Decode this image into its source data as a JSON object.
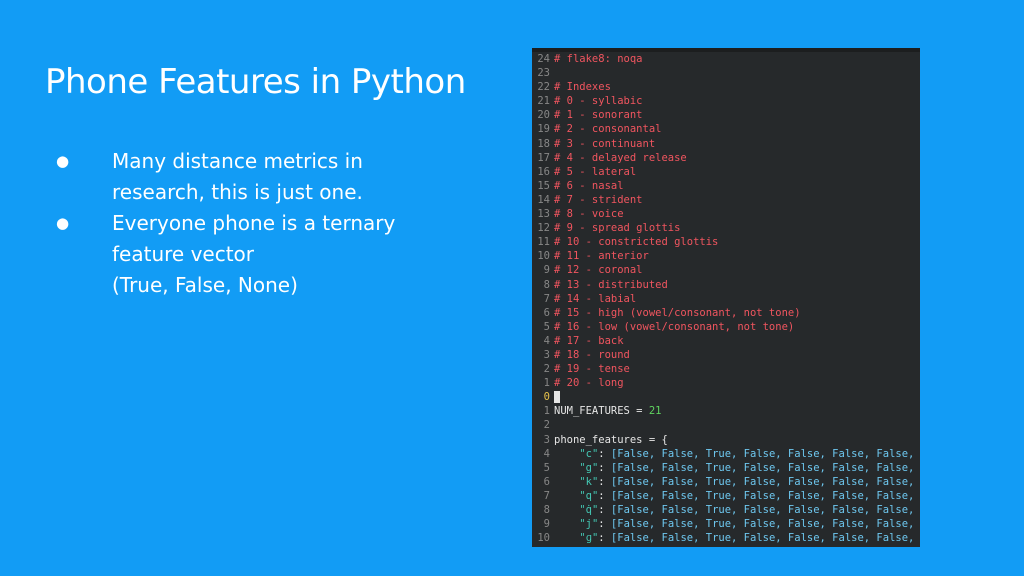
{
  "slide": {
    "title": "Phone Features in Python",
    "bullets": [
      {
        "lines": [
          "Many distance metrics in",
          "research, this is just one."
        ]
      },
      {
        "lines": [
          "Everyone phone is a ternary",
          "feature vector",
          "(True, False, None)"
        ]
      }
    ],
    "bullet_symbol": "●"
  },
  "editor": {
    "colors": {
      "background": "#26292b",
      "comment": "#f0555f",
      "string": "#44c8b4",
      "number": "#5fd35f",
      "line_number": "#878787",
      "current_line_number": "#e6c14c"
    },
    "comment_lines": [
      {
        "ln": "24",
        "text": "# flake8: noqa"
      },
      {
        "ln": "23",
        "text": ""
      },
      {
        "ln": "22",
        "text": "# Indexes"
      },
      {
        "ln": "21",
        "text": "# 0 - syllabic"
      },
      {
        "ln": "20",
        "text": "# 1 - sonorant"
      },
      {
        "ln": "19",
        "text": "# 2 - consonantal"
      },
      {
        "ln": "18",
        "text": "# 3 - continuant"
      },
      {
        "ln": "17",
        "text": "# 4 - delayed release"
      },
      {
        "ln": "16",
        "text": "# 5 - lateral"
      },
      {
        "ln": "15",
        "text": "# 6 - nasal"
      },
      {
        "ln": "14",
        "text": "# 7 - strident"
      },
      {
        "ln": "13",
        "text": "# 8 - voice"
      },
      {
        "ln": "12",
        "text": "# 9 - spread glottis"
      },
      {
        "ln": "11",
        "text": "# 10 - constricted glottis"
      },
      {
        "ln": "10",
        "text": "# 11 - anterior"
      },
      {
        "ln": "9",
        "text": "# 12 - coronal"
      },
      {
        "ln": "8",
        "text": "# 13 - distributed"
      },
      {
        "ln": "7",
        "text": "# 14 - labial"
      },
      {
        "ln": "6",
        "text": "# 15 - high (vowel/consonant, not tone)"
      },
      {
        "ln": "5",
        "text": "# 16 - low (vowel/consonant, not tone)"
      },
      {
        "ln": "4",
        "text": "# 17 - back"
      },
      {
        "ln": "3",
        "text": "# 18 - round"
      },
      {
        "ln": "2",
        "text": "# 19 - tense"
      },
      {
        "ln": "1",
        "text": "# 20 - long"
      }
    ],
    "cursor_line_number": "0",
    "num_features": {
      "ln": "1",
      "name": "NUM_FEATURES = ",
      "value": "21"
    },
    "blank_line_number": "2",
    "dict_open": {
      "ln": "3",
      "text": "phone_features = {"
    },
    "dict_rows": [
      {
        "ln": "4",
        "key": "\"c\"",
        "values": "[False, False, True, False, False, False, False, None,"
      },
      {
        "ln": "5",
        "key": "\"g\"",
        "values": "[False, False, True, False, False, False, False, None,"
      },
      {
        "ln": "6",
        "key": "\"k\"",
        "values": "[False, False, True, False, False, False, False, None,"
      },
      {
        "ln": "7",
        "key": "\"q\"",
        "values": "[False, False, True, False, False, False, False, None,"
      },
      {
        "ln": "8",
        "key": "\"q̇\"",
        "values": "[False, False, True, False, False, False, False, None,"
      },
      {
        "ln": "9",
        "key": "\"j\"",
        "values": "[False, False, True, False, False, False, False, None,"
      },
      {
        "ln": "10",
        "key": "\"ɡ\"",
        "values": "[False, False, True, False, False, False, False, None,"
      }
    ]
  }
}
